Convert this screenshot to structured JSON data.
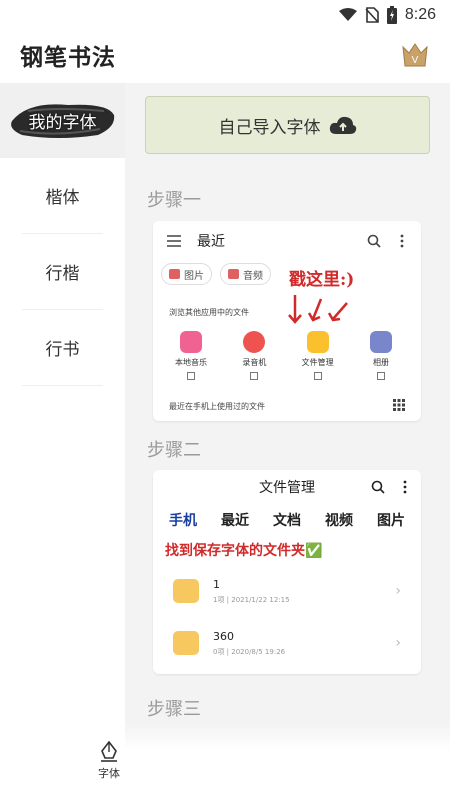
{
  "status": {
    "time": "8:26"
  },
  "app": {
    "title": "钢笔书法",
    "crown_letter": "V"
  },
  "sidebar": {
    "items": [
      {
        "label": "我的字体",
        "active": true
      },
      {
        "label": "楷体"
      },
      {
        "label": "行楷"
      },
      {
        "label": "行书"
      }
    ]
  },
  "main": {
    "import_label": "自己导入字体",
    "step1": "步骤一",
    "step2": "步骤二",
    "step3": "步骤三"
  },
  "card1": {
    "title": "最近",
    "chip_images": "图片",
    "chip_audio": "音频",
    "handwritten": "戳这里:)",
    "browse_text": "浏览其他应用中的文件",
    "apps": [
      {
        "name": "本地音乐",
        "color": "#f06292"
      },
      {
        "name": "录音机",
        "color": "#ef5350"
      },
      {
        "name": "文件管理",
        "color": "#fbc02d"
      },
      {
        "name": "相册",
        "color": "#7986cb"
      }
    ],
    "recent_text": "最近在手机上使用过的文件"
  },
  "card2": {
    "title": "文件管理",
    "tabs": [
      "手机",
      "最近",
      "文档",
      "视频",
      "图片"
    ],
    "handwritten": "找到保存字体的文件夹✅",
    "folders": [
      {
        "name": "1",
        "meta": "1项 | 2021/1/22 12:15"
      },
      {
        "name": "360",
        "meta": "0项 | 2020/8/5 19:26"
      }
    ]
  },
  "bottom_nav": {
    "font_label": "字体"
  },
  "colors": {
    "accent_tab": "#1a3ea0",
    "hand_red": "#d02a2a",
    "import_bg": "#e6ecd6"
  }
}
